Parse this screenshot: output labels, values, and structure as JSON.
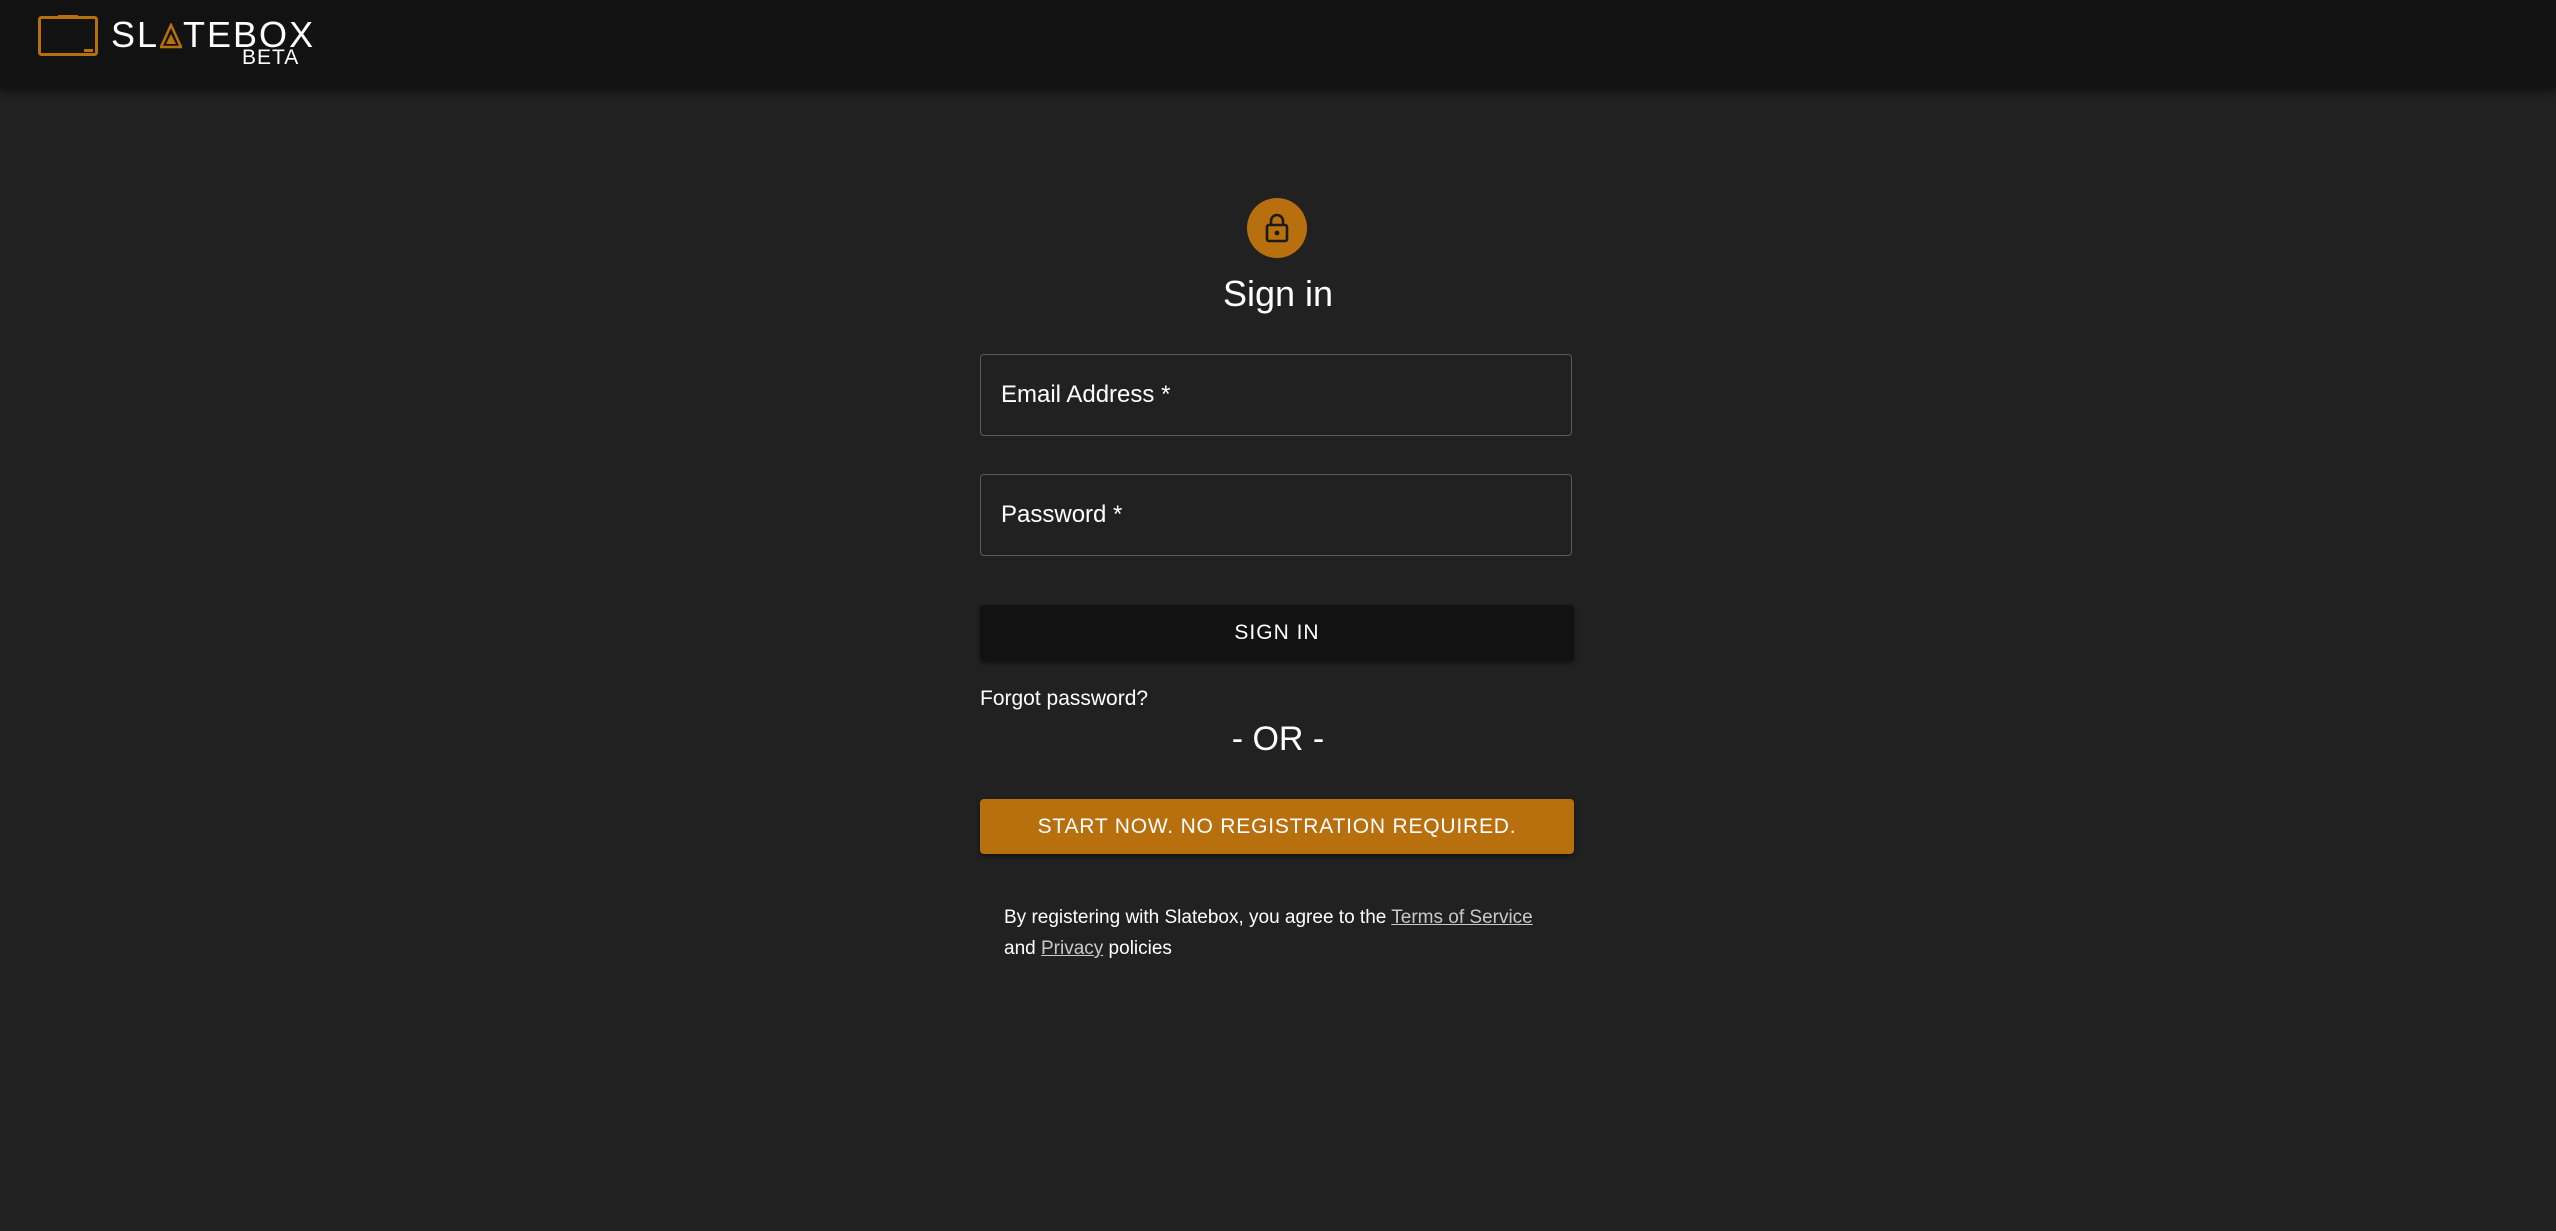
{
  "header": {
    "logo_word_left": "SL",
    "logo_word_right": "TEBOX",
    "logo_badge": "BETA",
    "logo_icon": "slatebox-logo-icon",
    "background_color": "#121212"
  },
  "signin": {
    "icon": "lock-icon",
    "title": "Sign in",
    "email_label": "Email Address *",
    "password_label": "Password *",
    "signin_button": "SIGN IN",
    "forgot_link": "Forgot password?",
    "or_divider": "- OR -",
    "start_button": "START NOW. NO REGISTRATION REQUIRED."
  },
  "terms": {
    "prefix": "By registering with Slatebox, you agree to the ",
    "terms_link": "Terms of Service",
    "middle": " and ",
    "privacy_link": "Privacy",
    "suffix": " policies"
  },
  "colors": {
    "accent": "#b8700f",
    "page_background": "#212121",
    "button_dark": "#121212",
    "text": "#ffffff"
  }
}
